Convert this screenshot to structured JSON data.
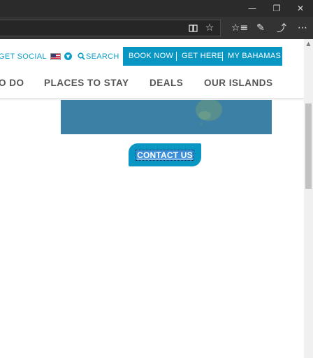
{
  "browser": {
    "window_buttons": {
      "minimize_icon": "minimize-icon",
      "restore_icon": "restore-icon",
      "close_icon": "close-icon"
    },
    "toolbar_icons": [
      "reading-view-icon",
      "favorite-star-icon",
      "favorites-list-icon",
      "pen-notes-icon",
      "share-icon",
      "more-icon"
    ]
  },
  "utility_nav": {
    "get_social": "GET SOCIAL",
    "country_flag": "us-flag-icon",
    "search": "SEARCH"
  },
  "cta_bar": {
    "book_now": "BOOK NOW",
    "get_here": "GET HERE",
    "my_bahamas": "MY BAHAMAS"
  },
  "main_nav": {
    "things_to_do": "O DO",
    "places_to_stay": "PLACES TO STAY",
    "deals": "DEALS",
    "our_islands": "OUR ISLANDS"
  },
  "contact": {
    "label": "CONTACT US"
  },
  "colors": {
    "brand_teal": "#0a96c3",
    "hero_blue": "#3d80a5",
    "nav_text": "#555555"
  }
}
